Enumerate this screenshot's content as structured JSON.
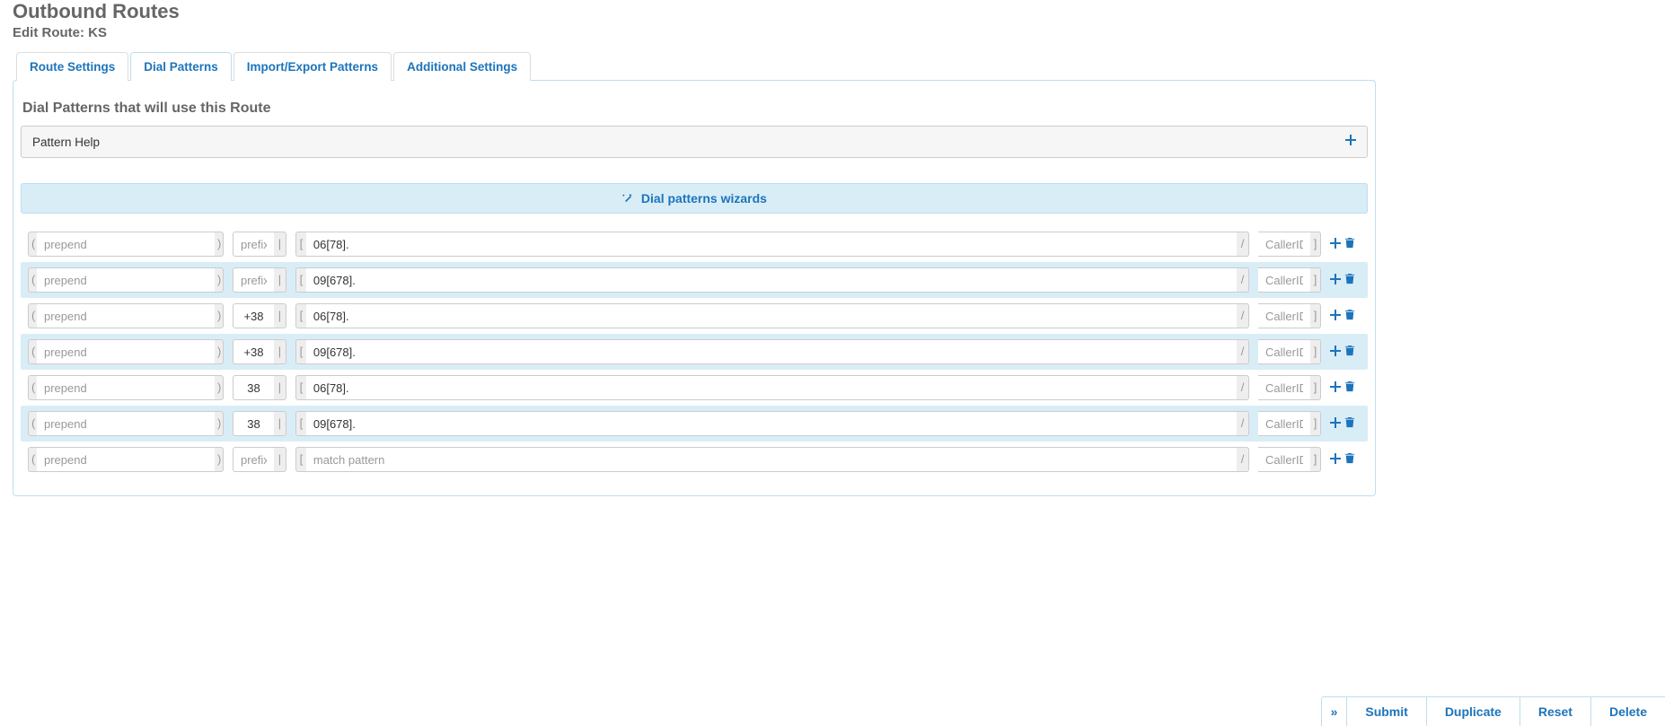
{
  "header": {
    "title": "Outbound Routes",
    "subtitle": "Edit Route: KS"
  },
  "tabs": [
    {
      "label": "Route Settings",
      "active": false
    },
    {
      "label": "Dial Patterns",
      "active": true
    },
    {
      "label": "Import/Export Patterns",
      "active": false
    },
    {
      "label": "Additional Settings",
      "active": false
    }
  ],
  "panel": {
    "section_title": "Dial Patterns that will use this Route",
    "help_label": "Pattern Help",
    "wizard_label": "Dial patterns wizards"
  },
  "placeholders": {
    "prepend": "prepend",
    "prefix": "prefix",
    "match": "match pattern",
    "callerid": "CallerID"
  },
  "decor": {
    "lparen": "(",
    "rparen": ")",
    "lbracket": "[",
    "rbracket": "]",
    "pipe": "|",
    "slash": "/"
  },
  "rows": [
    {
      "prepend": "",
      "prefix": "",
      "match": "06[78].",
      "callerid": ""
    },
    {
      "prepend": "",
      "prefix": "",
      "match": "09[678].",
      "callerid": ""
    },
    {
      "prepend": "",
      "prefix": "+38",
      "match": "06[78].",
      "callerid": ""
    },
    {
      "prepend": "",
      "prefix": "+38",
      "match": "09[678].",
      "callerid": ""
    },
    {
      "prepend": "",
      "prefix": "38",
      "match": "06[78].",
      "callerid": ""
    },
    {
      "prepend": "",
      "prefix": "38",
      "match": "09[678].",
      "callerid": ""
    },
    {
      "prepend": "",
      "prefix": "",
      "match": "",
      "callerid": ""
    }
  ],
  "footer": {
    "chevron": "»",
    "submit": "Submit",
    "duplicate": "Duplicate",
    "reset": "Reset",
    "delete": "Delete"
  }
}
